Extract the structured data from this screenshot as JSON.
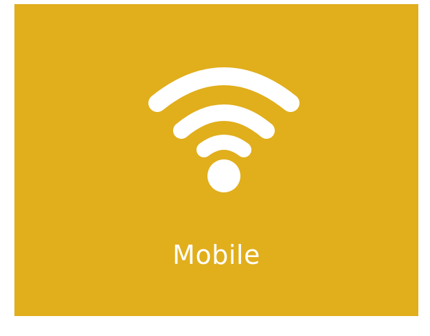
{
  "tile": {
    "label": "Mobile",
    "icon": "wifi-icon",
    "background_color": "#e1ae1c",
    "foreground_color": "#ffffff"
  }
}
